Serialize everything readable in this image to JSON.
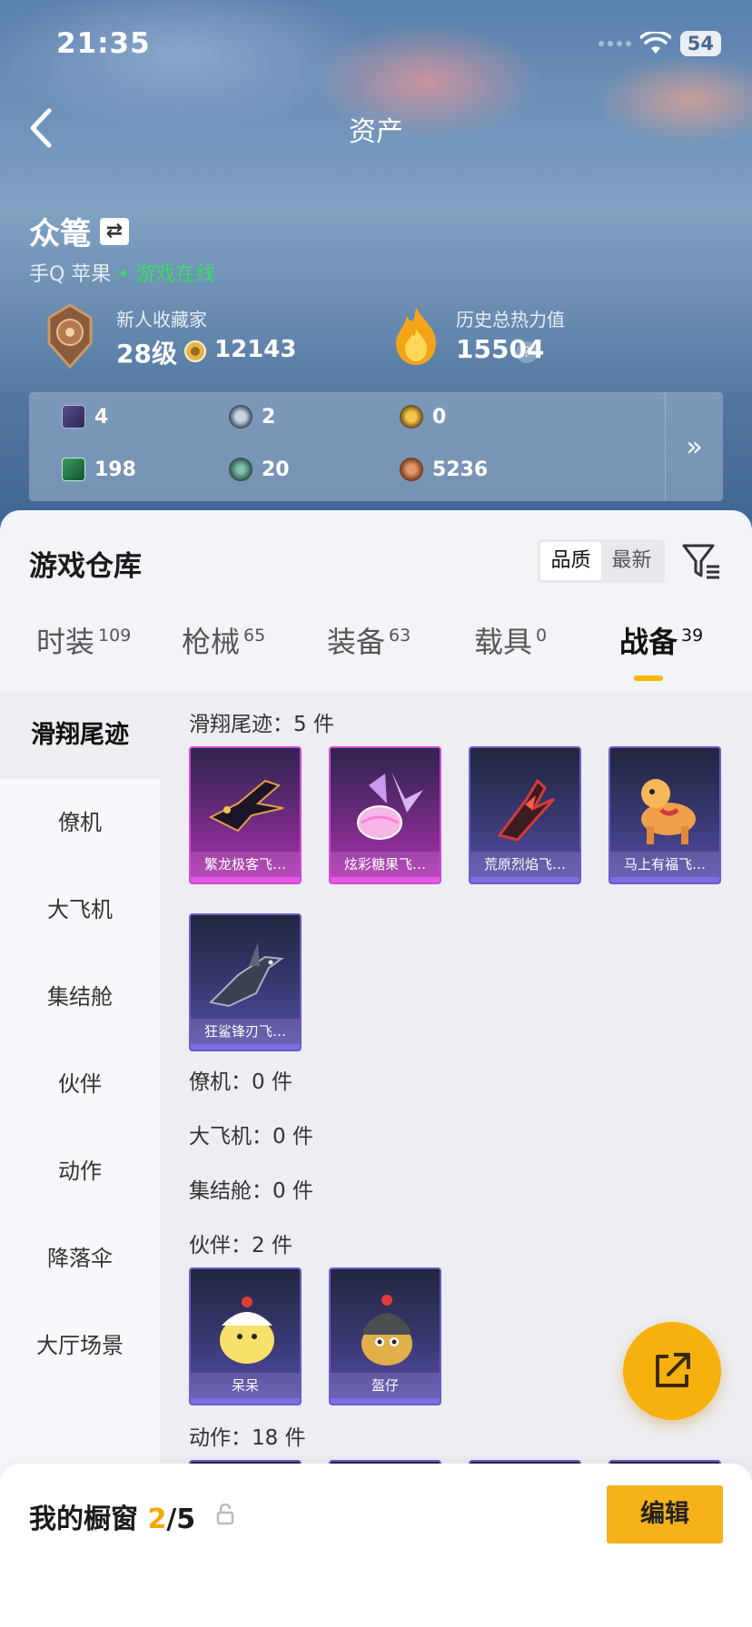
{
  "status_bar": {
    "time": "21:35",
    "battery": "54"
  },
  "header": {
    "title": "资产"
  },
  "player": {
    "name": "众篭",
    "platform": "手Q 苹果",
    "online_status": "• 游戏在线",
    "collector_title": "新人收藏家",
    "level": "28级",
    "coins": "12143",
    "heat_label": "历史总热力值",
    "heat_value": "15504"
  },
  "resources": [
    {
      "icon": "purple-card-icon",
      "value": "4"
    },
    {
      "icon": "silver-emblem-icon",
      "value": "2"
    },
    {
      "icon": "gold-emblem-icon",
      "value": "0"
    },
    {
      "icon": "green-card-icon",
      "value": "198"
    },
    {
      "icon": "orb-icon",
      "value": "20"
    },
    {
      "icon": "bronze-coin-icon",
      "value": "5236"
    }
  ],
  "warehouse": {
    "title": "游戏仓库",
    "sort_options": [
      "品质",
      "最新"
    ],
    "sort_selected": "品质",
    "tabs": [
      {
        "label": "时装",
        "count": "109"
      },
      {
        "label": "枪械",
        "count": "65"
      },
      {
        "label": "装备",
        "count": "63"
      },
      {
        "label": "载具",
        "count": "0"
      },
      {
        "label": "战备",
        "count": "39"
      }
    ],
    "active_tab": "战备",
    "categories": [
      "滑翔尾迹",
      "僚机",
      "大飞机",
      "集结舱",
      "伙伴",
      "动作",
      "降落伞",
      "大厅场景"
    ],
    "active_category": "滑翔尾迹",
    "sections": {
      "trail_header": "滑翔尾迹：5 件",
      "trail_items": [
        "繁龙极客飞…",
        "炫彩糖果飞…",
        "荒原烈焰飞…",
        "马上有福飞…",
        "狂鲨锋刃飞…"
      ],
      "wingman_header": "僚机：0 件",
      "plane_header": "大飞机：0 件",
      "pod_header": "集结舱：0 件",
      "partner_header": "伙伴：2 件",
      "partner_items": [
        "呆呆",
        "盔仔"
      ],
      "action_header": "动作：18 件"
    }
  },
  "showcase": {
    "label": "我的橱窗",
    "current": "2",
    "total": "/5",
    "edit_label": "编辑"
  },
  "colors": {
    "accent": "#f6b21a",
    "online": "#3bd96a",
    "rare_pink": "#d14ad6",
    "rare_blue": "#6a5cc6"
  }
}
